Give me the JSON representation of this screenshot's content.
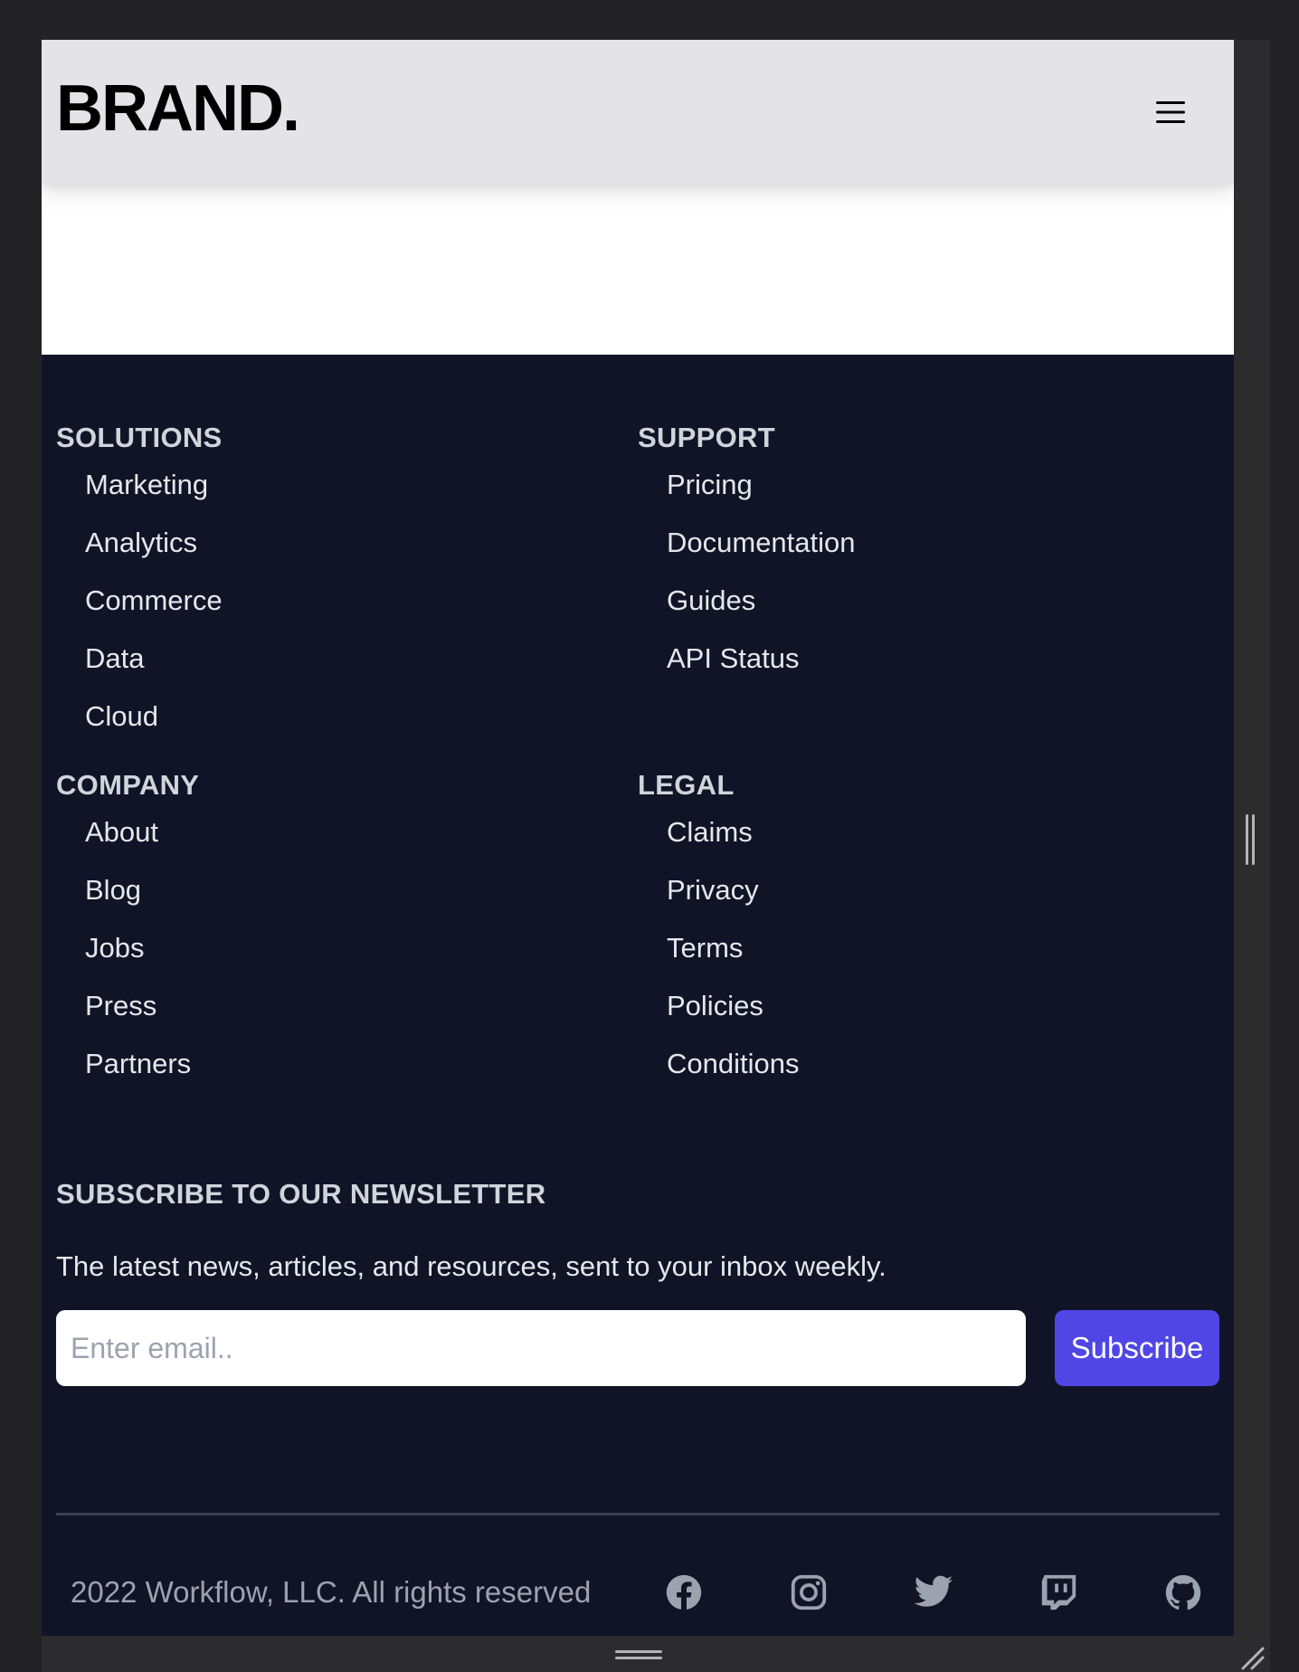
{
  "header": {
    "brand": "BRAND.",
    "menu_icon": "hamburger-menu-icon"
  },
  "footer": {
    "columns": [
      {
        "title": "SOLUTIONS",
        "links": [
          "Marketing",
          "Analytics",
          "Commerce",
          "Data",
          "Cloud"
        ]
      },
      {
        "title": "SUPPORT",
        "links": [
          "Pricing",
          "Documentation",
          "Guides",
          "API Status"
        ]
      },
      {
        "title": "COMPANY",
        "links": [
          "About",
          "Blog",
          "Jobs",
          "Press",
          "Partners"
        ]
      },
      {
        "title": "LEGAL",
        "links": [
          "Claims",
          "Privacy",
          "Terms",
          "Policies",
          "Conditions"
        ]
      }
    ],
    "newsletter": {
      "title": "SUBSCRIBE TO OUR NEWSLETTER",
      "description": "The latest news, articles, and resources, sent to your inbox weekly.",
      "email_placeholder": "Enter email..",
      "button_label": "Subscribe"
    },
    "copyright": "2022 Workflow, LLC. All rights reserved",
    "social_icons": [
      "facebook-icon",
      "instagram-icon",
      "twitter-icon",
      "twitch-icon",
      "github-icon"
    ]
  },
  "colors": {
    "footer_bg": "#111427",
    "accent": "#4f46e5",
    "navbar_bg": "#e4e4e7"
  }
}
